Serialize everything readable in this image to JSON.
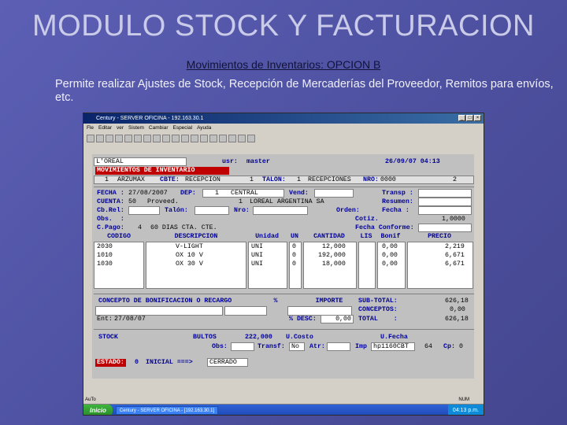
{
  "slide": {
    "title": "MODULO STOCK Y FACTURACION",
    "subtitle": "Movimientos de Inventarios:  OPCION B",
    "desc": "Permite realizar Ajustes de Stock, Recepción de Mercaderías del Proveedor, Remitos para envíos, etc."
  },
  "window": {
    "title": "Century - SERVER OFICINA - 192.163.30.1",
    "menu": [
      "Fle",
      "Editar",
      "ver",
      "Sistem",
      "Cambiar",
      "Especial",
      "Ayuda"
    ]
  },
  "screen": {
    "company": "L'OREAL",
    "user_label": "usr:",
    "user": "master",
    "datetime": "26/09/07 04:13",
    "banner": "MOVIMIENTOS DE INVENTARIO",
    "deposit_code": "1",
    "deposit": "ARZUMAX",
    "cbte_label": "CBTE:",
    "cbte": "RECEPCION",
    "cbte_code": "1",
    "talon_label": "TALON:",
    "talon_code": "1",
    "talon": "RECEPCIONES",
    "nro_label": "NRO:",
    "nro": "0000",
    "nro2": "2",
    "fecha_label": "FECHA :",
    "fecha": "27/08/2007",
    "dep_label": "DEP:",
    "dep_code": "1",
    "dep": "CENTRAL",
    "vend_label": "Vend:",
    "transp_label": "Transp :",
    "cuenta_label": "CUENTA:",
    "cuenta": "50",
    "cuenta_type": "Proveed.",
    "cuenta_code": "1",
    "cuenta_name": "LOREAL ARGENTINA SA",
    "resumen_label": "Resumen:",
    "corel_label": "Cb.Rel:",
    "talon2_label": "Talón:",
    "nro2_label": "Nro:",
    "orden_label": "Orden:",
    "fecha2_label": "Fecha :",
    "obs_label": "Obs.  :",
    "cotiz_label": "Cotiz.",
    "cotiz": "1,0000",
    "cpago_label": "C.Pago:",
    "cpago_code": "4",
    "cpago": "60 DIAS CTA. CTE.",
    "fecha_conforme_label": "Fecha Conforme:",
    "cols": [
      "CODIGO",
      "DESCRIPCION",
      "Unidad",
      "UN",
      "CANTIDAD",
      "LIS",
      "Bonif",
      "PRECIO"
    ],
    "rows": [
      [
        "2030",
        "V-LIGHT",
        "UNI",
        "0",
        "12,000",
        "",
        "0,00",
        "2,219"
      ],
      [
        "1010",
        "OX 10 V",
        "UNI",
        "0",
        "192,000",
        "",
        "0,00",
        "6,671"
      ],
      [
        "1030",
        "OX 30 V",
        "UNI",
        "0",
        "18,000",
        "",
        "0,00",
        "6,671"
      ]
    ],
    "concepto_hdr": "CONCEPTO DE BONIFICACION O RECARGO",
    "pct_hdr": "%",
    "importe_hdr": "IMPORTE",
    "subtotal_label": "SUB-TOTAL:",
    "subtotal": "626,18",
    "conceptos_label": "CONCEPTOS:",
    "conceptos": "0,00",
    "total_label": "TOTAL    :",
    "total": "626,18",
    "ent_label": "Ent:",
    "ent": "27/08/07",
    "desc_label": "% DESC:",
    "desc": "0,00",
    "stock_label": "STOCK",
    "bultos_label": "BULTOS",
    "bultos": "222,000",
    "ucosto_label": "U.Costo",
    "ufecha_label": "U.Fecha",
    "obs2_label": "Obs:",
    "transf_label": "Transf:",
    "transf": "No",
    "atr_label": "Atr:",
    "imp_label": "Imp",
    "imp": "hp1160CBT",
    "imp_num": "64",
    "cp_label": "Cp:",
    "cp": "0",
    "estado_label": "ESTADO:",
    "estado_code": "0",
    "estado": "INICIAL ===>",
    "estado_btn": "CERRADO"
  },
  "taskbar": {
    "status": "AuTo",
    "start": "Inicio",
    "task": "Century - SERVER OFICINA - [192.163.30.1]",
    "num": "NUM",
    "time": "04:13 p.m."
  }
}
